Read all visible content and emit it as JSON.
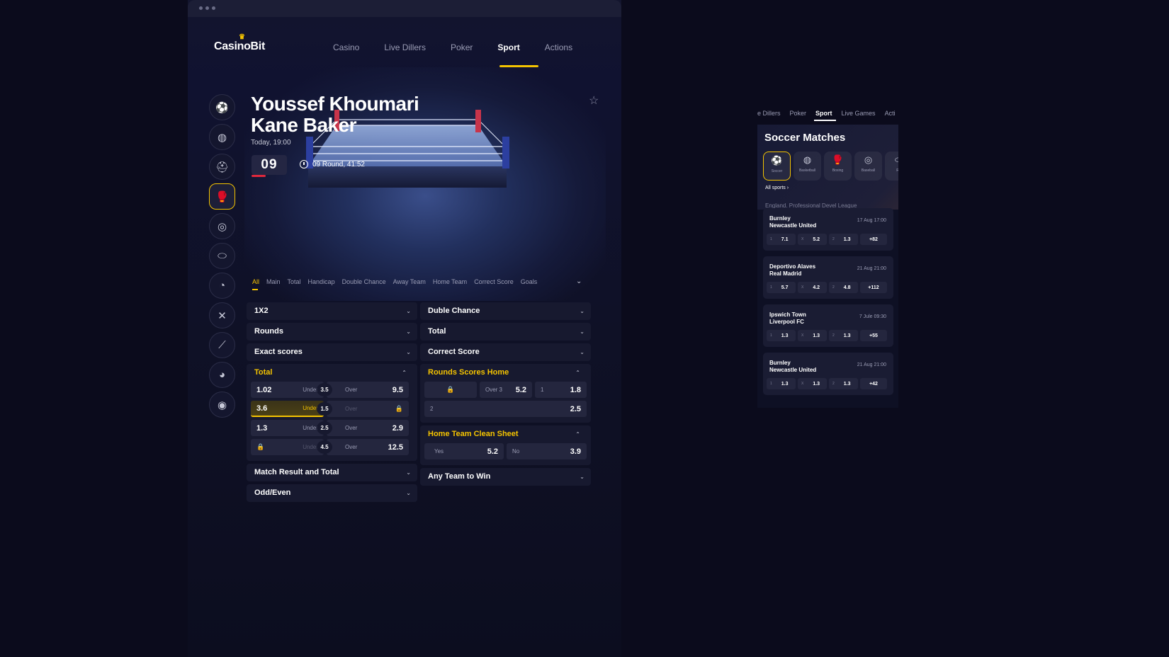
{
  "nav": {
    "brand": "CasinoBit",
    "items": [
      "Casino",
      "Live Dillers",
      "Poker",
      "Sport",
      "Actions"
    ],
    "active": "Sport"
  },
  "event": {
    "player1": "Youssef Khoumari",
    "player2": "Kane Baker",
    "time": "Today, 19:00",
    "round_number": "09",
    "round_info": "09 Round, 41:52"
  },
  "sidebar": {
    "icons": [
      "soccer-icon",
      "basketball-icon",
      "football-helmet-icon",
      "boxing-glove-icon",
      "volleyball-icon",
      "rugby-icon",
      "tennis-icon",
      "hockey-icon",
      "baseball-icon",
      "table-tennis-icon",
      "darts-icon"
    ],
    "active_index": 3
  },
  "market_tabs": {
    "items": [
      "All",
      "Main",
      "Total",
      "Handicap",
      "Double Chance",
      "Away Team",
      "Home Team",
      "Correct Score",
      "Goals"
    ],
    "active": "All"
  },
  "left_markets": {
    "m1": "1X2",
    "m2": "Rounds",
    "m3": "Exact scores",
    "total": {
      "title": "Total",
      "rows": [
        {
          "left": "1.02",
          "under": "Under",
          "mid": "3.5",
          "over": "Over",
          "right": "9.5"
        },
        {
          "left": "3.6",
          "under": "Under",
          "mid": "1.5",
          "over": "Over",
          "right": ""
        },
        {
          "left": "1.3",
          "under": "Under",
          "mid": "2.5",
          "over": "Over",
          "right": "2.9"
        },
        {
          "left": "",
          "under": "Under",
          "mid": "4.5",
          "over": "Over",
          "right": "12.5"
        }
      ]
    },
    "m4": "Match Result and Total",
    "m5": "Odd/Even"
  },
  "right_markets": {
    "m1": "Duble Chance",
    "m2": "Total",
    "m3": "Correct Score",
    "rounds_scores_home": {
      "title": "Rounds Scores Home",
      "row1": {
        "over_label": "Over 3",
        "over_val": "5.2",
        "one_label": "1",
        "one_val": "1.8"
      },
      "row2": {
        "label": "2",
        "val": "2.5"
      }
    },
    "clean_sheet": {
      "title": "Home Team Clean Sheet",
      "yes_label": "Yes",
      "yes_val": "5.2",
      "no_label": "No",
      "no_val": "3.9"
    },
    "m4": "Any Team to Win"
  },
  "mobile": {
    "nav": [
      "e Dillers",
      "Poker",
      "Sport",
      "Live Games",
      "Acti"
    ],
    "title": "Soccer Matches",
    "sports": [
      "Soccer",
      "Basketball",
      "Boxing",
      "Baseball",
      "Ru"
    ],
    "all_sports": "All sports",
    "league": "England. Professional Devel League",
    "matches": [
      {
        "home": "Burnley",
        "away": "Newcastle United",
        "date": "17 Aug 17:00",
        "o1": "7.1",
        "ox": "5.2",
        "o2": "1.3",
        "more": "+82"
      },
      {
        "home": "Deportivo Alaves",
        "away": "Real Madrid",
        "date": "21 Aug 21:00",
        "o1": "5.7",
        "ox": "4.2",
        "o2": "4.8",
        "more": "+112"
      },
      {
        "home": "Ipswich Town",
        "away": "Liverpool FC",
        "date": "7 Jule 09:30",
        "o1": "1.3",
        "ox": "1.3",
        "o2": "1.3",
        "more": "+55"
      },
      {
        "home": "Burnley",
        "away": "Newcastle United",
        "date": "21 Aug 21:00",
        "o1": "1.3",
        "ox": "1.3",
        "o2": "1.3",
        "more": "+42"
      }
    ],
    "k1": "1",
    "kx": "X",
    "k2": "2"
  },
  "colors": {
    "accent": "#f5c400",
    "background": "#0b0b1c",
    "card": "#17192f",
    "live_red": "#e0283c"
  }
}
